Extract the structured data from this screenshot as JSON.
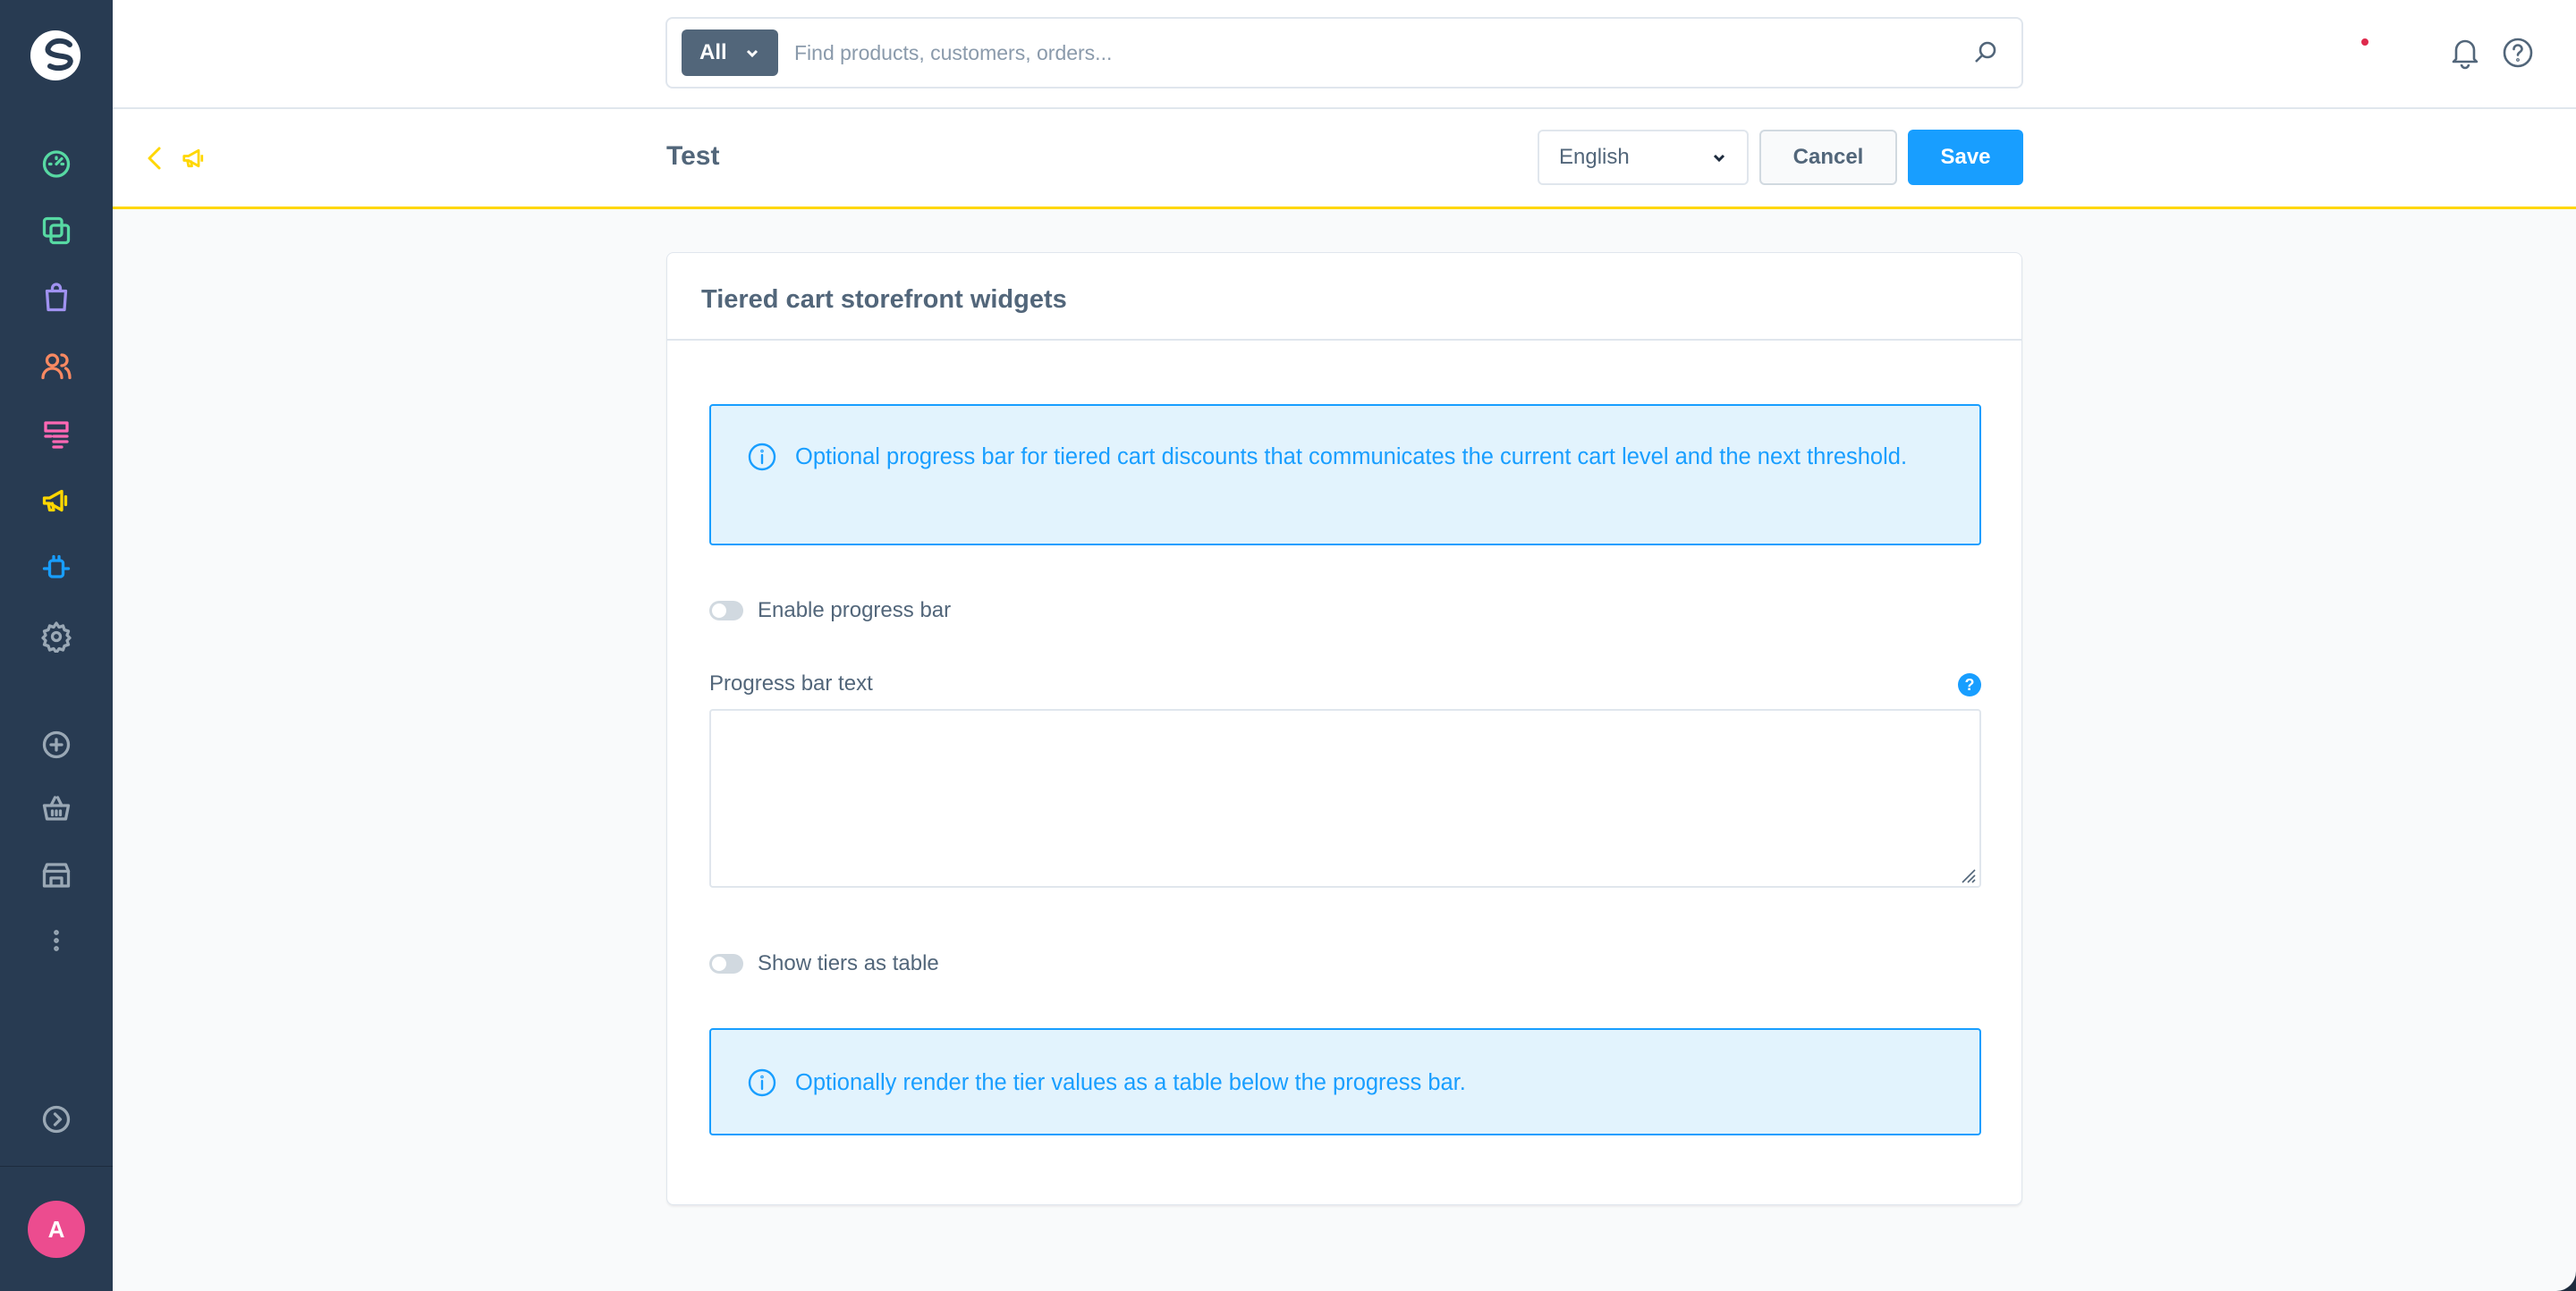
{
  "sidebar": {
    "logo": "shopware-logo-icon",
    "nav": [
      {
        "icon": "dashboard-icon",
        "color": "#57d9a3"
      },
      {
        "icon": "catalogue-icon",
        "color": "#57d9a3"
      },
      {
        "icon": "orders-icon",
        "color": "#a092f0"
      },
      {
        "icon": "customers-icon",
        "color": "#f88962"
      },
      {
        "icon": "content-icon",
        "color": "#ff68b4"
      },
      {
        "icon": "marketing-icon",
        "color": "#ffd700"
      },
      {
        "icon": "extensions-icon",
        "color": "#189eff"
      },
      {
        "icon": "settings-icon",
        "color": "#9aa8b5"
      }
    ],
    "secondary": [
      "add-sales-channel-icon",
      "storefront-icon",
      "headless-icon",
      "more-icon"
    ],
    "collapse_icon": "chevron-right-circle-icon",
    "avatar": "A",
    "avatar_color": "#ec4c8f"
  },
  "topbar": {
    "search_type": "All",
    "search_placeholder": "Find products, customers, orders...",
    "notification_icon": "bell-icon",
    "help_icon": "help-icon"
  },
  "smartbar": {
    "title": "Test",
    "language": "English",
    "cancel_label": "Cancel",
    "save_label": "Save"
  },
  "card": {
    "title": "Tiered cart storefront widgets",
    "alert1": "Optional progress bar for tiered cart discounts that communicates the current cart level and the next threshold.",
    "toggle_progress_label": "Enable progress bar",
    "progress_text_label": "Progress bar text",
    "progress_text_value": "",
    "help_symbol": "?",
    "toggle_table_label": "Show tiers as table",
    "alert2": "Optionally render the tier values as a table below the progress bar."
  },
  "colors": {
    "accent": "#189eff",
    "sidebar_bg": "#283b52",
    "smartbar_border": "#ffd700"
  }
}
